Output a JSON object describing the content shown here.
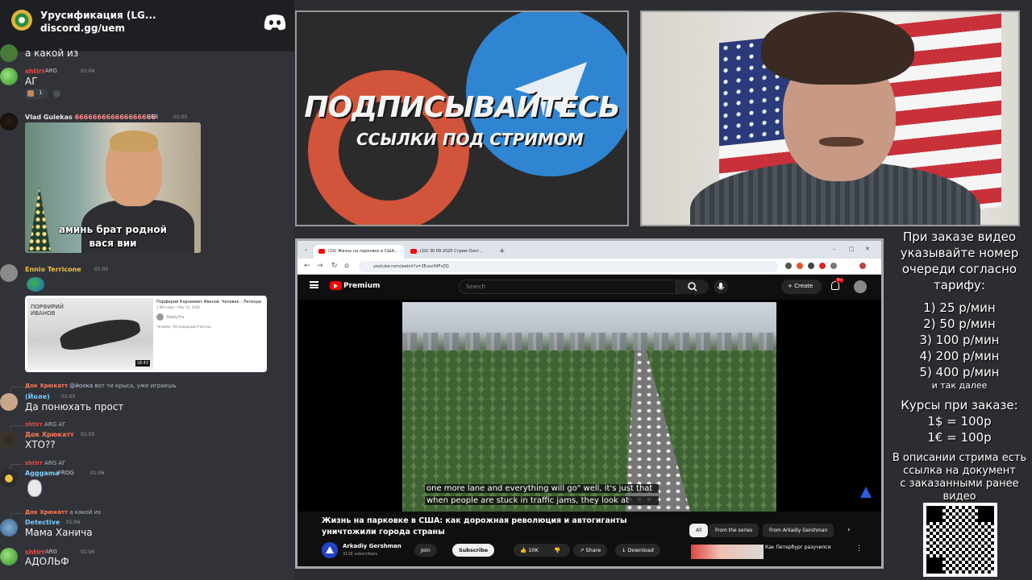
{
  "discord": {
    "server_name": "Урусификация (LG...",
    "server_link": "discord.gg/uem",
    "messages": [
      {
        "text": "а какой из"
      },
      {
        "user": "shtirr",
        "tag": "ARG",
        "time": "01:04",
        "text": "АГ",
        "reaction_count": "1"
      },
      {
        "user": "Vlad Gulekas",
        "user_suffix": "666666666666666666",
        "tag": "UEB",
        "time": "01:05",
        "meme_caption": "аминь брат родной",
        "meme_caption2": "вася вии"
      },
      {
        "user": "Ennio Terricone",
        "time": "01:05"
      },
      {
        "user": "(Йоле)",
        "time": "01:05",
        "reply_user": "Док Хрюкатт",
        "reply_mention": "@йолка",
        "reply_text": "вот ти крыса, уже играешь",
        "text": "Да понюхать прост"
      },
      {
        "user": "Док Хрюкатт",
        "time": "01:05",
        "reply_user": "shtirr",
        "reply_tag": "ARG",
        "reply_text": "АГ",
        "text": "ХТО??"
      },
      {
        "user": "Agggama",
        "tag": "FROG",
        "time": "01:06",
        "reply_user": "shtirr",
        "reply_tag": "ARG",
        "reply_text": "АГ"
      },
      {
        "user": "Detective",
        "time": "01:06",
        "reply_user": "Док Хрюкатт",
        "reply_text": "а какой из",
        "text": "Мама Ханича"
      },
      {
        "user": "shtirr",
        "tag": "ARG",
        "time": "01:06",
        "text": "АДОЛЬФ"
      }
    ],
    "embed": {
      "title": "Порфирий Корнеевич Иванов. Человек - Легенда",
      "meta": "1.6M views • Mar 11, 2020",
      "channel": "Family Fire",
      "desc": "Человек, Легендарный Учитель...",
      "overlay": "ПОРФИРИЙ ИВАНОВ",
      "duration": "18:43"
    }
  },
  "promo": {
    "headline": "ПОДПИСЫВАЙТЕСЬ",
    "subline": "ССЫЛКИ ПОД СТРИМОМ"
  },
  "browser": {
    "tabs": [
      {
        "label": "(19) Жизнь на парковке в США..."
      },
      {
        "label": "(10) 30 09 2025 Стрим Охот..."
      }
    ],
    "url": "youtube.com/watch?v=3Eusz34FvZQ"
  },
  "youtube": {
    "brand": "Premium",
    "search_placeholder": "Search",
    "create_label": "Create",
    "notif_badge": "9+",
    "subtitle_line1": "one more lane and everything will go\" well, it's just that",
    "subtitle_line2": "when people are stuck in traffic jams, they look at",
    "video_title": "Жизнь на парковке в США: как дорожная революция и автогиганты уничтожили города страны",
    "chips": [
      "All",
      "From the series",
      "From Arkadiy Gershman"
    ],
    "channel_name": "Arkadiy Gershman",
    "channel_subs": "311K subscribers",
    "join_label": "Join",
    "subscribe_label": "Subscribe",
    "likes": "10K",
    "share_label": "Share",
    "download_label": "Download",
    "related_title": "Как Петербург разучился"
  },
  "info_panel": {
    "order_lines": [
      "При заказе видео",
      "указывайте номер",
      "очереди согласно",
      "тарифу:"
    ],
    "tariffs": [
      "1) 25 р/мин",
      "2) 50 р/мин",
      "3) 100 р/мин",
      "4) 200 р/мин",
      "5) 400 р/мин"
    ],
    "etc": "и так далее",
    "rates_title": "Курсы при заказе:",
    "rates": [
      "1$ = 100р",
      "1€ = 100р"
    ],
    "desc_lines": [
      "В описании стрима есть",
      "ссылка на документ",
      "с заказанными ранее",
      "видео"
    ]
  },
  "colors": {
    "discord_bg": "#313338",
    "youtube_red": "#ff0000",
    "promo_orange": "#d2543a",
    "telegram_blue": "#2f85d2"
  }
}
